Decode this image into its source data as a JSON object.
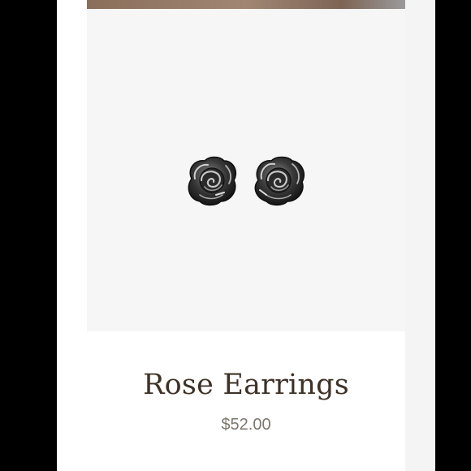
{
  "product": {
    "title": "Rose Earrings",
    "price": "$52.00",
    "image_subject": "silver rose stud earrings pair"
  },
  "colors": {
    "page_background": "#000000",
    "panel_background": "#ffffff",
    "image_background": "#f7f6f6",
    "title_color": "#3e3227",
    "price_color": "#7d766f",
    "earring_metal_dark": "#1f1f1f",
    "earring_metal_light": "#bdbdbd"
  },
  "icons": {
    "earring_left": "rose-stud-icon",
    "earring_right": "rose-stud-icon"
  }
}
